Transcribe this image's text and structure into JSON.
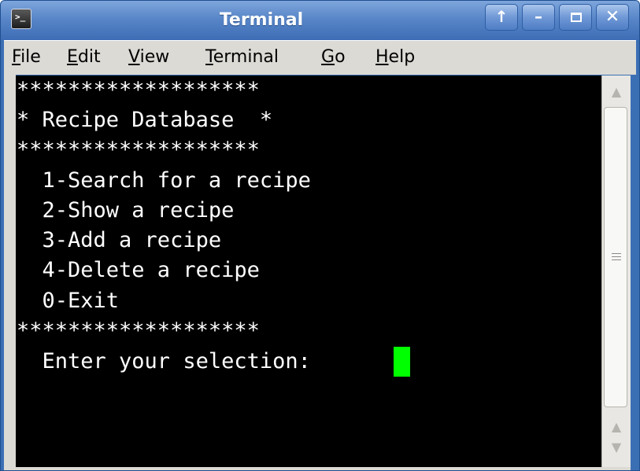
{
  "window": {
    "title": "Terminal",
    "icon": "terminal-icon",
    "icon_glyph": ">_",
    "controls": {
      "up_glyph": "↑",
      "minimize_glyph": "–",
      "close_glyph": "✕"
    }
  },
  "menubar": {
    "items": [
      {
        "mnemonic": "F",
        "rest": "ile"
      },
      {
        "mnemonic": "E",
        "rest": "dit"
      },
      {
        "mnemonic": "V",
        "rest": "iew"
      },
      {
        "mnemonic": "T",
        "rest": "erminal"
      },
      {
        "mnemonic": "G",
        "rest": "o"
      },
      {
        "mnemonic": "H",
        "rest": "elp"
      }
    ]
  },
  "terminal": {
    "lines": [
      "*******************",
      "* Recipe Database  *",
      "*******************",
      "  1-Search for a recipe",
      "  2-Show a recipe",
      "  3-Add a recipe",
      "  4-Delete a recipe",
      "  0-Exit",
      "*******************",
      "  Enter your selection: "
    ],
    "cursor_color": "#00ff00",
    "background": "#000000",
    "foreground": "#ffffff"
  },
  "scrollbar": {
    "up_glyph": "▲",
    "down_glyph": "▼"
  },
  "colors": {
    "titlebar": "#4f7ec5",
    "menubar": "#dcdad5"
  }
}
